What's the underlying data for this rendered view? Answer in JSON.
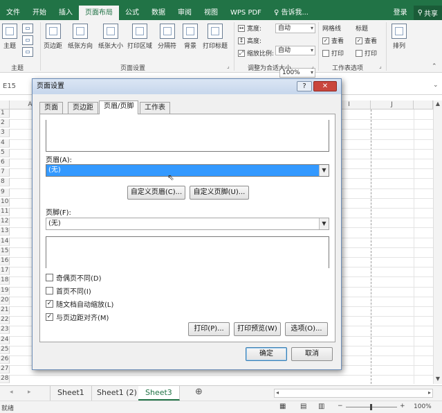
{
  "menu": {
    "tabs": [
      "文件",
      "开始",
      "插入",
      "页面布局",
      "公式",
      "数据",
      "审阅",
      "视图",
      "WPS PDF"
    ],
    "active_tab": "页面布局",
    "tell_me": "告诉我...",
    "login": "登录",
    "share": "共享"
  },
  "ribbon": {
    "theme_label": "主题",
    "group_theme": "主题",
    "margins": "页边距",
    "orientation": "纸张方向",
    "size": "纸张大小",
    "print_area": "打印区域",
    "breaks": "分隔符",
    "background": "背景",
    "print_titles": "打印标题",
    "group_page_setup": "页面设置",
    "width_label": "宽度:",
    "width_value": "自动",
    "height_label": "高度:",
    "height_value": "自动",
    "scale_label": "缩放比例:",
    "scale_value": "100%",
    "group_scale": "调整为合适大小",
    "gridlines": "网格线",
    "headings": "标题",
    "view": "查看",
    "print": "打印",
    "group_sheet_options": "工作表选项",
    "arrange": "排列"
  },
  "formula_bar": {
    "name_box": "E15"
  },
  "grid": {
    "rows": [
      "1",
      "2",
      "3",
      "4",
      "5",
      "6",
      "7",
      "8",
      "9",
      "10",
      "11",
      "12",
      "13",
      "14",
      "15",
      "16",
      "17",
      "18",
      "19",
      "20",
      "21",
      "22",
      "23",
      "24",
      "25",
      "26",
      "27",
      "28"
    ],
    "visible_columns": [
      "A",
      "I",
      "J"
    ]
  },
  "dialog": {
    "title": "页面设置",
    "help": "?",
    "tabs": [
      "页面",
      "页边距",
      "页眉/页脚",
      "工作表"
    ],
    "active_tab": "页眉/页脚",
    "header_label": "页眉(A):",
    "header_value": "(无)",
    "custom_header": "自定义页眉(C)...",
    "custom_footer": "自定义页脚(U)...",
    "footer_label": "页脚(F):",
    "footer_value": "(无)",
    "options": [
      {
        "label": "奇偶页不同(D)",
        "checked": false
      },
      {
        "label": "首页不同(I)",
        "checked": false
      },
      {
        "label": "随文档自动缩放(L)",
        "checked": true
      },
      {
        "label": "与页边距对齐(M)",
        "checked": true
      }
    ],
    "print": "打印(P)...",
    "print_preview": "打印预览(W)",
    "options_button": "选项(O)...",
    "ok": "确定",
    "cancel": "取消"
  },
  "sheets": {
    "tabs": [
      "Sheet1",
      "Sheet1 (2)",
      "Sheet3"
    ],
    "active": "Sheet3"
  },
  "status": {
    "ready": "就绪",
    "zoom": "100%"
  },
  "colors": {
    "brand": "#217346",
    "selection": "#3399ff"
  }
}
